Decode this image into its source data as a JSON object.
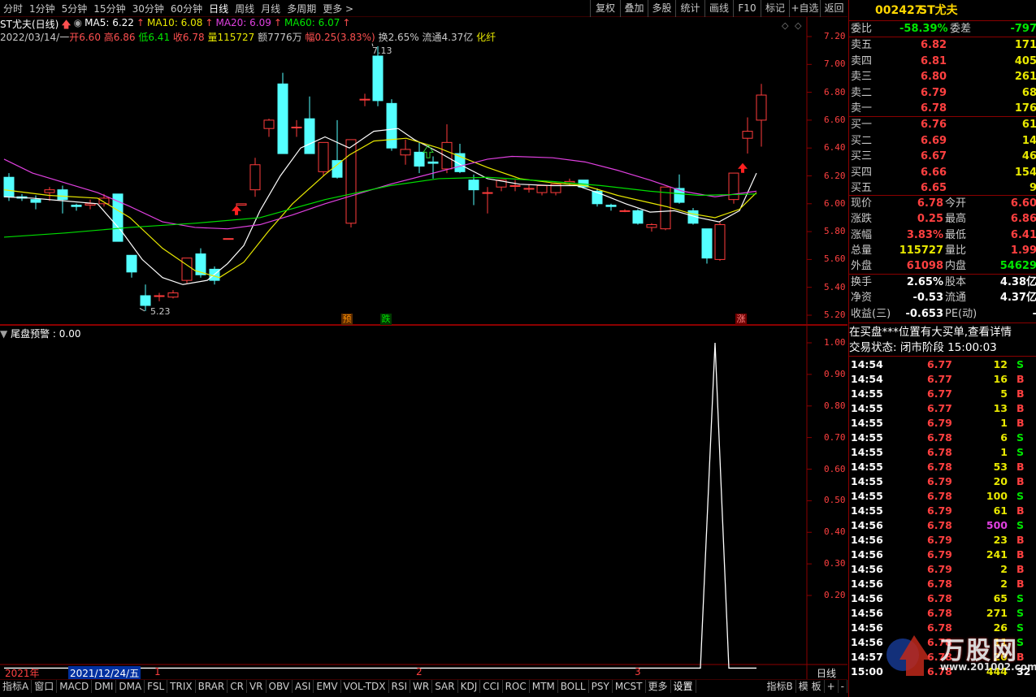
{
  "periods": [
    "分时",
    "1分钟",
    "5分钟",
    "15分钟",
    "30分钟",
    "60分钟",
    "日线",
    "周线",
    "月线",
    "多周期",
    "更多 >"
  ],
  "active_period": "日线",
  "toolbar": [
    "复权",
    "叠加",
    "多股",
    "统计",
    "画线",
    "F10",
    "标记",
    "+自选",
    "返回"
  ],
  "stock": {
    "title": "ST尤夫(日线)"
  },
  "ma": {
    "ma5": "MA5: 6.22",
    "ma10": "MA10: 6.08",
    "ma20": "MA20: 6.09",
    "ma60": "MA60: 6.07"
  },
  "bar_info": {
    "date": "2022/03/14/一",
    "open_lbl": "开",
    "open": "6.60",
    "high_lbl": "高",
    "high": "6.86",
    "low_lbl": "低",
    "low": "6.41",
    "close_lbl": "收",
    "close": "6.78",
    "vol_lbl": "量",
    "vol": "115727",
    "amt_lbl": "额",
    "amt": "7776万",
    "chg_lbl": "幅",
    "chg": "0.25(3.83%)",
    "turn_lbl": "换",
    "turn": "2.65%",
    "float_lbl": "流通",
    "float": "4.37亿",
    "tag": "化纤"
  },
  "price_axis": [
    "7.20",
    "7.00",
    "6.80",
    "6.60",
    "6.40",
    "6.20",
    "6.00",
    "5.80",
    "5.60",
    "5.40",
    "5.20"
  ],
  "price_marks": {
    "high": "7.13",
    "low": "5.23"
  },
  "signals": [
    "预",
    "跌",
    "涨"
  ],
  "indicator": {
    "title": "尾盘预警",
    "value": ": 0.00"
  },
  "ind_axis": [
    "1.00",
    "0.90",
    "0.80",
    "0.70",
    "0.60",
    "0.50",
    "0.40",
    "0.30",
    "0.20"
  ],
  "time_axis": {
    "year": "2021年",
    "cursor_date": "2021/12/24/五",
    "months": [
      "1",
      "2",
      "3"
    ],
    "unit": "日线"
  },
  "bottom_tabs": [
    "指标A",
    "窗口",
    "MACD",
    "DMI",
    "DMA",
    "FSL",
    "TRIX",
    "BRAR",
    "CR",
    "VR",
    "OBV",
    "ASI",
    "EMV",
    "VOL-TDX",
    "RSI",
    "WR",
    "SAR",
    "KDJ",
    "CCI",
    "ROC",
    "MTM",
    "BOLL",
    "PSY",
    "MCST",
    "更多",
    "设置"
  ],
  "bottom_right": [
    "指标B",
    "模 板",
    "+",
    "-"
  ],
  "quote": {
    "code": "002427",
    "name": "ST尤夫",
    "weibi_lbl": "委比",
    "weibi": "-58.39%",
    "weicha_lbl": "委差",
    "weicha": "-797",
    "asks": [
      {
        "lbl": "卖五",
        "p": "6.82",
        "v": "171"
      },
      {
        "lbl": "卖四",
        "p": "6.81",
        "v": "405"
      },
      {
        "lbl": "卖三",
        "p": "6.80",
        "v": "261"
      },
      {
        "lbl": "卖二",
        "p": "6.79",
        "v": "68"
      },
      {
        "lbl": "卖一",
        "p": "6.78",
        "v": "176"
      }
    ],
    "bids": [
      {
        "lbl": "买一",
        "p": "6.76",
        "v": "61"
      },
      {
        "lbl": "买二",
        "p": "6.69",
        "v": "14"
      },
      {
        "lbl": "买三",
        "p": "6.67",
        "v": "46"
      },
      {
        "lbl": "买四",
        "p": "6.66",
        "v": "154"
      },
      {
        "lbl": "买五",
        "p": "6.65",
        "v": "9"
      }
    ],
    "stats": [
      {
        "l1": "现价",
        "v1": "6.78",
        "l2": "今开",
        "v2": "6.60"
      },
      {
        "l1": "涨跌",
        "v1": "0.25",
        "l2": "最高",
        "v2": "6.86"
      },
      {
        "l1": "涨幅",
        "v1": "3.83%",
        "l2": "最低",
        "v2": "6.41"
      },
      {
        "l1": "总量",
        "v1": "115727",
        "l2": "量比",
        "v2": "1.99"
      },
      {
        "l1": "外盘",
        "v1": "61098",
        "l2": "内盘",
        "v2": "54629"
      }
    ],
    "stats2": [
      {
        "l1": "换手",
        "v1": "2.65%",
        "l2": "股本",
        "v2": "4.38亿"
      },
      {
        "l1": "净资",
        "v1": "-0.53",
        "l2": "流通",
        "v2": "4.37亿"
      },
      {
        "l1": "收益(三)",
        "v1": "-0.653",
        "l2": "PE(动)",
        "v2": "-"
      }
    ],
    "notice": "在买盘***位置有大买单,查看详情",
    "status": "交易状态: 闭市阶段 15:00:03"
  },
  "ticks": [
    {
      "t": "14:54",
      "p": "6.77",
      "v": "12",
      "s": "S"
    },
    {
      "t": "14:54",
      "p": "6.77",
      "v": "16",
      "s": "B"
    },
    {
      "t": "14:55",
      "p": "6.77",
      "v": "5",
      "s": "B"
    },
    {
      "t": "14:55",
      "p": "6.77",
      "v": "13",
      "s": "B"
    },
    {
      "t": "14:55",
      "p": "6.79",
      "v": "1",
      "s": "B"
    },
    {
      "t": "14:55",
      "p": "6.78",
      "v": "6",
      "s": "S"
    },
    {
      "t": "14:55",
      "p": "6.78",
      "v": "1",
      "s": "S"
    },
    {
      "t": "14:55",
      "p": "6.78",
      "v": "53",
      "s": "B"
    },
    {
      "t": "14:55",
      "p": "6.79",
      "v": "20",
      "s": "B"
    },
    {
      "t": "14:55",
      "p": "6.78",
      "v": "100",
      "s": "S"
    },
    {
      "t": "14:55",
      "p": "6.79",
      "v": "61",
      "s": "B"
    },
    {
      "t": "14:56",
      "p": "6.78",
      "v": "500",
      "s": "S"
    },
    {
      "t": "14:56",
      "p": "6.79",
      "v": "23",
      "s": "B"
    },
    {
      "t": "14:56",
      "p": "6.79",
      "v": "241",
      "s": "B"
    },
    {
      "t": "14:56",
      "p": "6.79",
      "v": "2",
      "s": "B"
    },
    {
      "t": "14:56",
      "p": "6.78",
      "v": "2",
      "s": "B"
    },
    {
      "t": "14:56",
      "p": "6.78",
      "v": "65",
      "s": "S"
    },
    {
      "t": "14:56",
      "p": "6.78",
      "v": "271",
      "s": "S"
    },
    {
      "t": "14:56",
      "p": "6.78",
      "v": "26",
      "s": "S"
    },
    {
      "t": "14:56",
      "p": "6.78",
      "v": "11",
      "s": "S"
    },
    {
      "t": "14:57",
      "p": "6.78",
      "v": "20",
      "s": "B"
    },
    {
      "t": "15:00",
      "p": "6.78",
      "v": "444",
      "s": "32"
    }
  ],
  "watermark": {
    "text": "万股网",
    "url": "www.201002.com"
  },
  "colors": {
    "up": "#ff3c3c",
    "down": "#54ffff",
    "ma5": "#ffffff",
    "ma10": "#e8e800",
    "ma20": "#e040e0",
    "ma60": "#00dd00",
    "grid": "#8b0000"
  }
}
